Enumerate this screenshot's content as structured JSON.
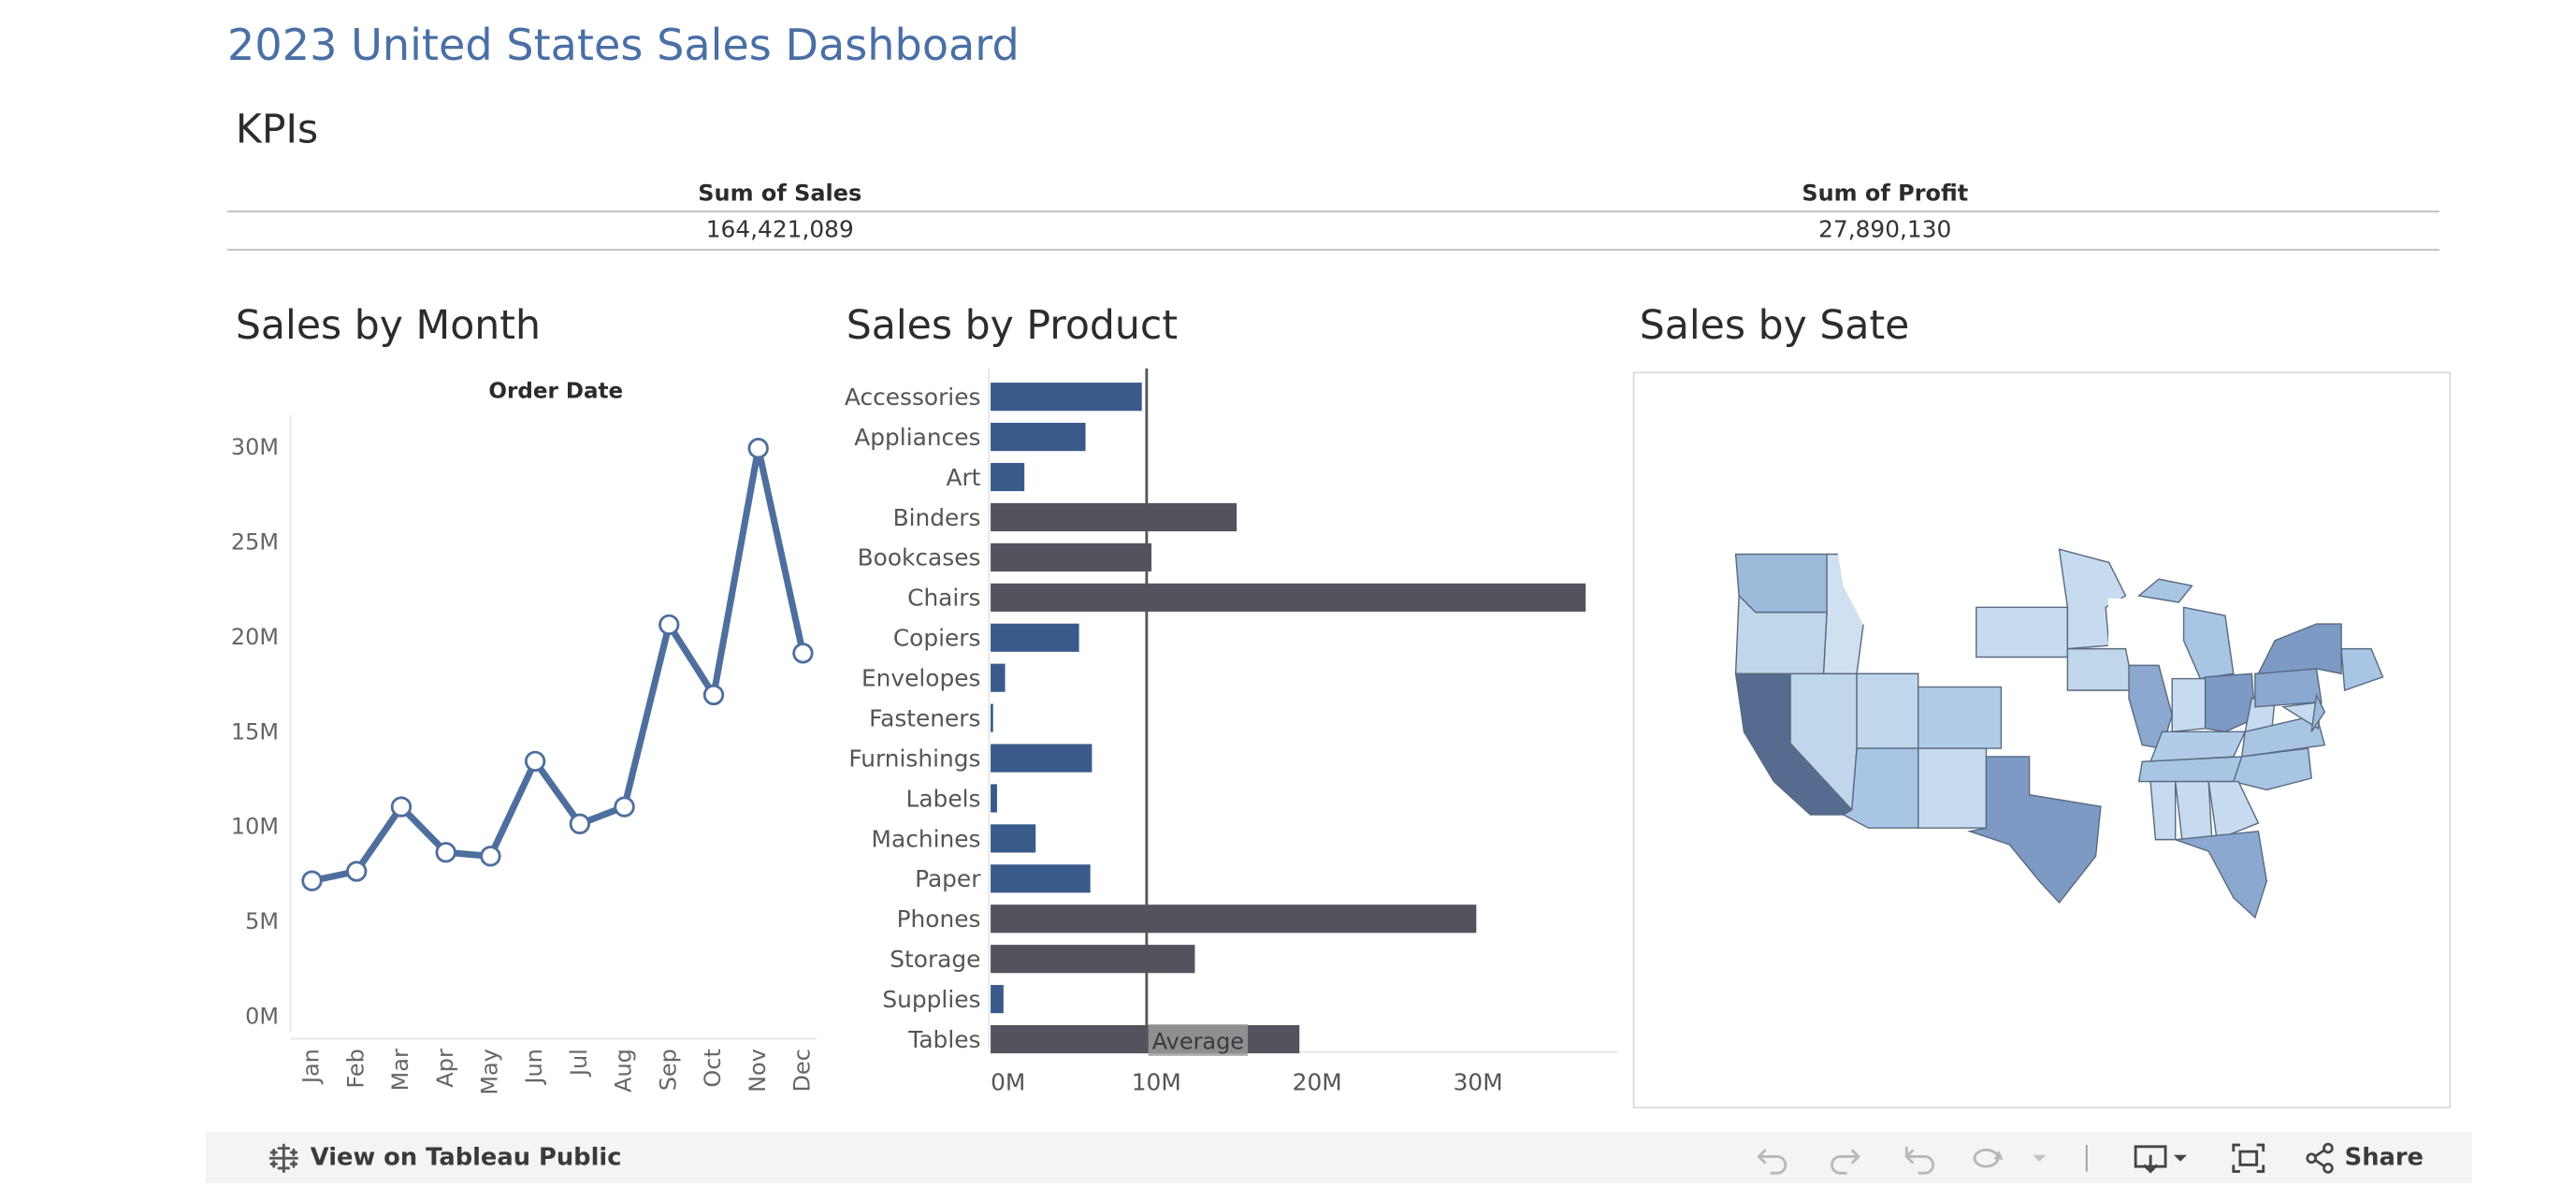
{
  "dashboard": {
    "title": "2023 United States Sales Dashboard"
  },
  "kpis": {
    "title": "KPIs",
    "sales_label": "Sum of Sales",
    "sales_value": "164,421,089",
    "profit_label": "Sum of Profit",
    "profit_value": "27,890,130"
  },
  "sales_by_month": {
    "title": "Sales by Month"
  },
  "sales_by_product": {
    "title": "Sales by Product"
  },
  "sales_by_state": {
    "title": "Sales by Sate"
  },
  "chart_data": [
    {
      "type": "line",
      "title": "Order Date",
      "x": [
        "Jan",
        "Feb",
        "Mar",
        "Apr",
        "May",
        "Jun",
        "Jul",
        "Aug",
        "Sep",
        "Oct",
        "Nov",
        "Dec"
      ],
      "series": [
        {
          "values": [
            7.1,
            7.6,
            11.0,
            8.6,
            8.4,
            13.4,
            10.1,
            11.0,
            20.6,
            16.9,
            29.9,
            19.1
          ]
        }
      ],
      "y_ticks": [
        "0M",
        "5M",
        "10M",
        "15M",
        "20M",
        "25M",
        "30M"
      ],
      "ylim": [
        0,
        30
      ],
      "color": "#4e6f9e"
    },
    {
      "type": "bar",
      "orientation": "horizontal",
      "categories": [
        "Accessories",
        "Appliances",
        "Art",
        "Binders",
        "Bookcases",
        "Chairs",
        "Copiers",
        "Envelopes",
        "Fasteners",
        "Furnishings",
        "Labels",
        "Machines",
        "Paper",
        "Phones",
        "Storage",
        "Supplies",
        "Tables"
      ],
      "values": [
        9.4,
        5.9,
        2.1,
        15.3,
        10.0,
        37.0,
        5.5,
        0.9,
        0.1,
        6.3,
        0.4,
        2.8,
        6.2,
        30.2,
        12.7,
        0.8,
        19.2
      ],
      "above_average": [
        false,
        false,
        false,
        true,
        true,
        true,
        false,
        false,
        false,
        false,
        false,
        false,
        false,
        true,
        true,
        false,
        true
      ],
      "x_ticks": [
        "0M",
        "10M",
        "20M",
        "30M"
      ],
      "xlim": [
        0,
        39
      ],
      "reference_line": {
        "label": "Average",
        "value": 9.7
      },
      "colors": {
        "below_average": "#3a5a8c",
        "above_average": "#52535d"
      }
    }
  ],
  "toolbar": {
    "view_label": "View on Tableau Public",
    "share_label": "Share"
  }
}
